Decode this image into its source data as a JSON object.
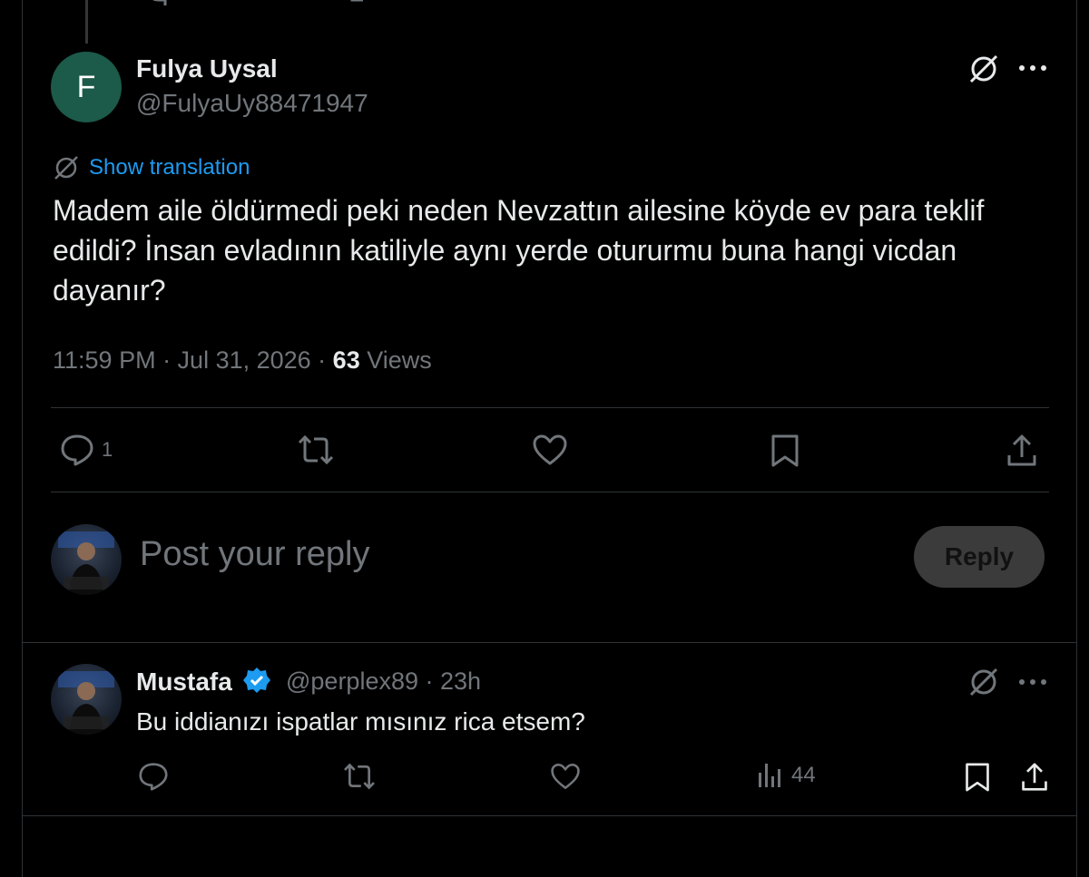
{
  "tweet": {
    "avatar_letter": "F",
    "name": "Fulya Uysal",
    "handle": "@FulyaUy88471947",
    "show_translation": "Show translation",
    "text": "Madem aile öldürmedi peki neden Nevzattın ailesine köyde ev para teklif edildi? İnsan evladının katiliyle aynı yerde otururmu buna hangi vicdan dayanır?",
    "time": "11:59 PM · Jul 31, 2026 · ",
    "views_count": "63",
    "views_label": " Views",
    "reply_count": "1"
  },
  "composer": {
    "placeholder": "Post your reply",
    "button_label": "Reply"
  },
  "reply": {
    "name": "Mustafa",
    "handle_time": "@perplex89 · 23h",
    "text": "Bu iddianızı ispatlar mısınız rica etsem?",
    "views_count": "44"
  },
  "colors": {
    "background": "#000000",
    "text": "#e7e9ea",
    "muted": "#71767b",
    "link": "#1d9bf0",
    "verified": "#1d9bf0",
    "like_pink": "#f91880"
  },
  "icons": [
    "grok-icon",
    "more-icon",
    "reply-icon",
    "retweet-icon",
    "like-icon",
    "bookmark-icon",
    "share-icon",
    "views-icon",
    "verified-badge-icon",
    "translate-icon"
  ]
}
